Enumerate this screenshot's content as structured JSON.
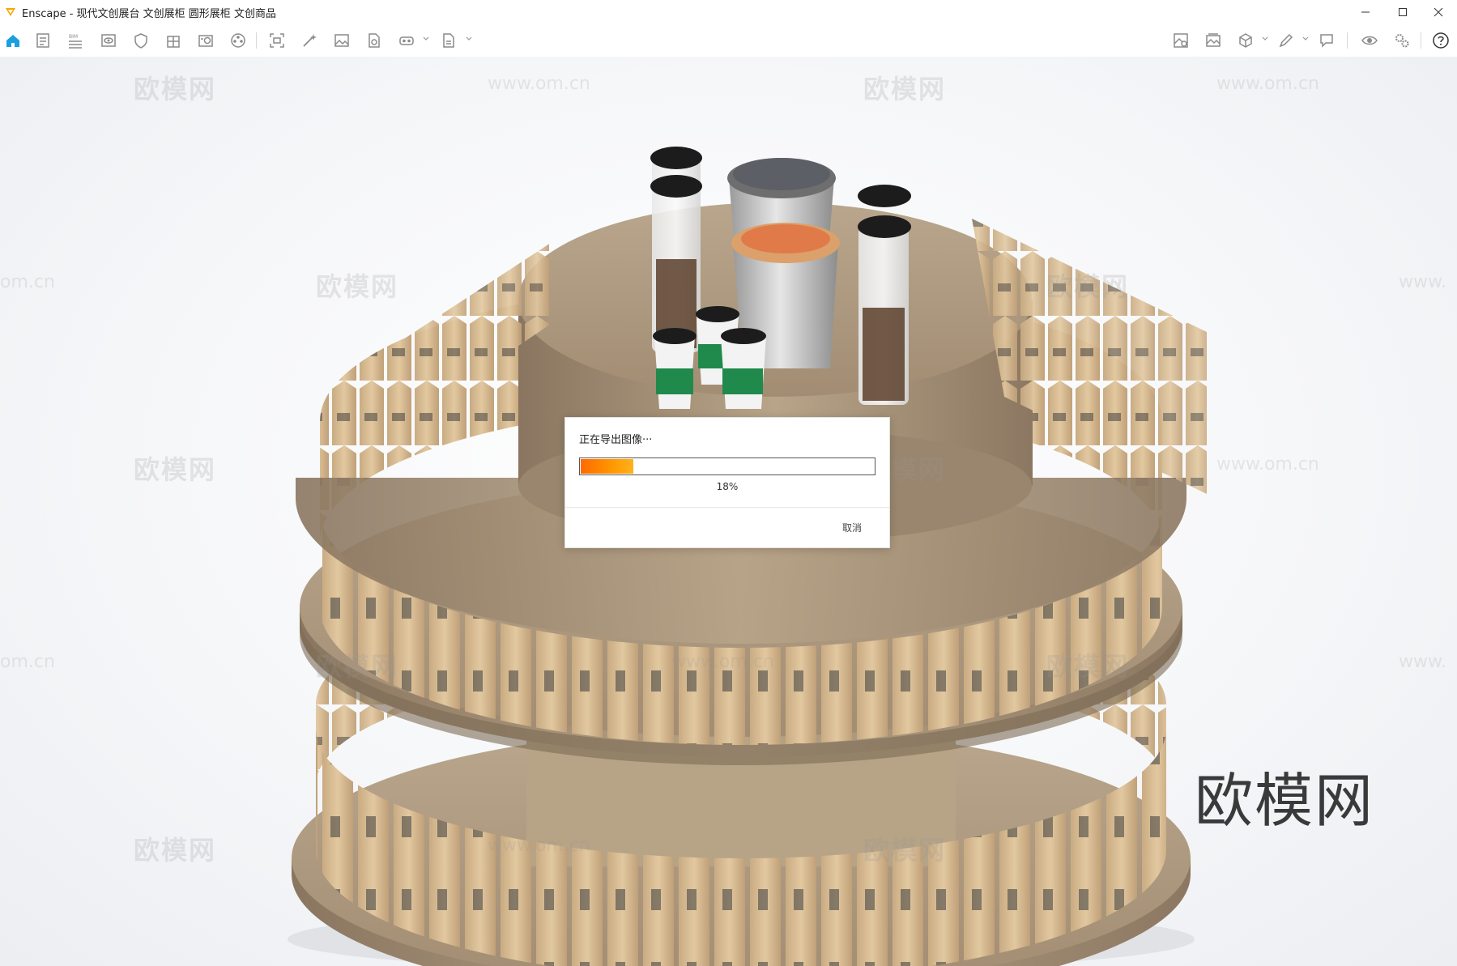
{
  "window": {
    "app_name": "Enscape",
    "title": "Enscape - 现代文创展台 文创展柜 圆形展柜 文创商品",
    "minimize_icon": "minimize-icon",
    "maximize_icon": "maximize-icon",
    "close_icon": "close-icon"
  },
  "toolbar": {
    "left_icons": [
      "home-icon",
      "document-icon",
      "bim-icon",
      "view-icon",
      "shield-icon",
      "building-icon",
      "camera-list-icon",
      "film-icon",
      "screenshot-icon",
      "magic-wand-icon",
      "image-icon",
      "export-panorama-icon",
      "vr-headset-icon",
      "export-file-icon"
    ],
    "right_icons": [
      "asset-library-icon",
      "gallery-icon",
      "cube-icon",
      "pen-icon",
      "chat-icon",
      "eye-icon",
      "settings-gears-icon",
      "help-icon"
    ],
    "accent_color": "#1a9fe0"
  },
  "viewport": {
    "watermark_text": "欧模网",
    "watermark_url": "www.om.cn",
    "watermark_url_short": "om.cn",
    "watermark_url_prefix": "www.",
    "brand_watermark": "欧模网"
  },
  "dialog": {
    "title": "正在导出图像···",
    "progress": 0.18,
    "progress_label": "18%",
    "cancel_label": "取消",
    "progress_color": "#ff8a00"
  }
}
